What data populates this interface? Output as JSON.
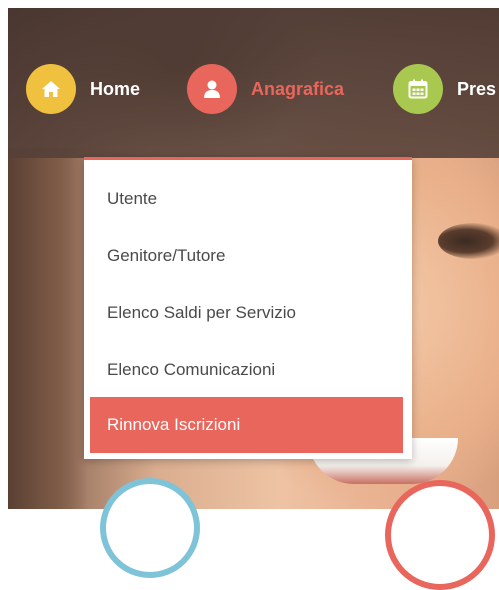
{
  "nav": {
    "items": [
      {
        "label": "Home",
        "icon": "home-icon",
        "color": "#f0c13e"
      },
      {
        "label": "Anagrafica",
        "icon": "user-icon",
        "color": "#e8665c",
        "active": true
      },
      {
        "label": "Pres",
        "icon": "calendar-icon",
        "color": "#a8c84f"
      }
    ]
  },
  "dropdown": {
    "items": [
      {
        "label": "Utente"
      },
      {
        "label": "Genitore/Tutore"
      },
      {
        "label": "Elenco Saldi per Servizio"
      },
      {
        "label": "Elenco Comunicazioni"
      },
      {
        "label": "Rinnova Iscrizioni",
        "active": true
      }
    ]
  },
  "colors": {
    "accent": "#e8665c",
    "home": "#f0c13e",
    "presenze": "#a8c84f",
    "text": "#4a4a4a"
  }
}
